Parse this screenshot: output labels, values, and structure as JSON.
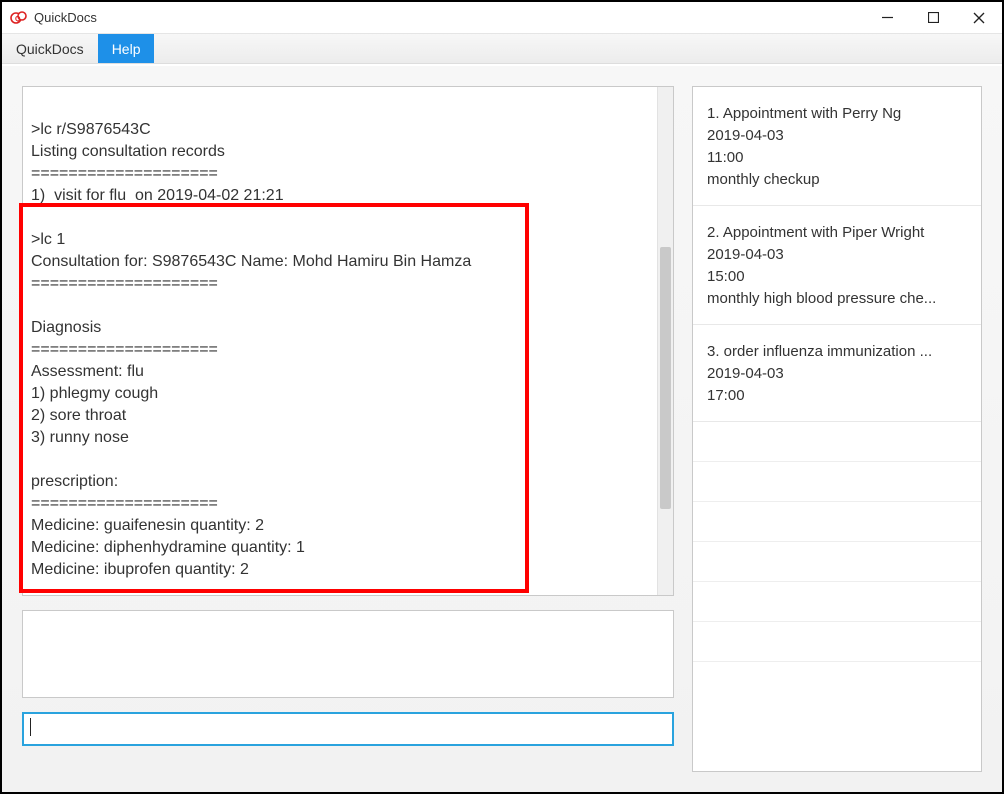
{
  "window": {
    "title": "QuickDocs"
  },
  "menu": {
    "items": [
      "QuickDocs",
      "Help"
    ],
    "active_index": 1
  },
  "console": {
    "block1": {
      "cmd": ">lc r/S9876543C",
      "heading": "Listing consultation records",
      "divider": "====================",
      "row": "1)  visit for flu  on 2019-04-02 21:21"
    },
    "block2": {
      "cmd": ">lc 1",
      "header": "Consultation for: S9876543C Name: Mohd Hamiru Bin Hamza",
      "divider1": "====================",
      "diag_title": "Diagnosis",
      "divider2": "====================",
      "assessment": "Assessment: flu",
      "sym1": "1) phlegmy cough",
      "sym2": "2) sore throat",
      "sym3": "3) runny nose",
      "presc_title": "prescription:",
      "divider3": "====================",
      "med1": "Medicine: guaifenesin quantity: 2",
      "med2": "Medicine: diphenhydramine quantity: 1",
      "med3": "Medicine: ibuprofen quantity: 2"
    }
  },
  "command_input": {
    "value": ""
  },
  "appointments": [
    {
      "title": "1.   Appointment with Perry Ng",
      "date": "2019-04-03",
      "time": "11:00",
      "note": "monthly checkup"
    },
    {
      "title": "2.   Appointment with Piper Wright",
      "date": "2019-04-03",
      "time": "15:00",
      "note": "monthly high blood pressure che..."
    },
    {
      "title": "3.   order influenza immunization ...",
      "date": "2019-04-03",
      "time": "17:00",
      "note": ""
    }
  ]
}
